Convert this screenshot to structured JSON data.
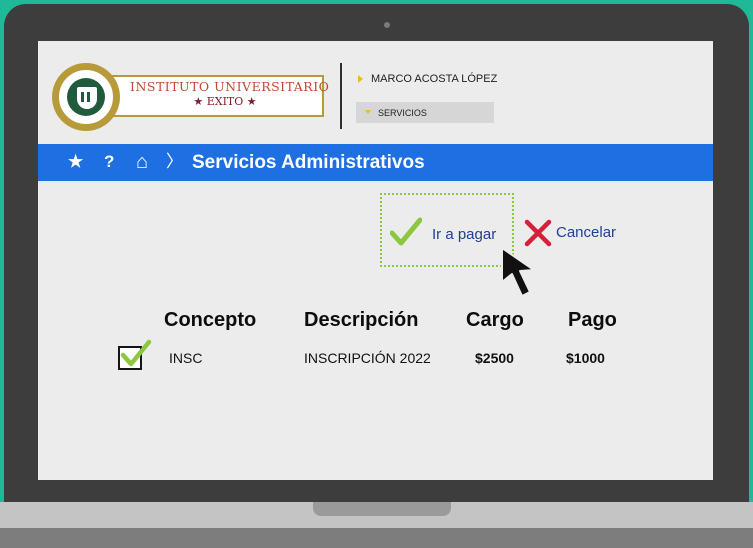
{
  "logo": {
    "name_line1": "INSTITUTO UNIVERSITARIO",
    "name_line2": "★ EXITO ★"
  },
  "user": {
    "name": "MARCO ACOSTA LÓPEZ"
  },
  "menu": {
    "services_label": "SERVICIOS"
  },
  "nav": {
    "icons": [
      "star-icon",
      "help-icon",
      "home-icon",
      "chevron-right-icon"
    ],
    "star_glyph": "★",
    "help_glyph": "?",
    "home_glyph": "⌂",
    "chevron_glyph": "〉",
    "title": "Servicios Administrativos"
  },
  "actions": {
    "pay_label": "Ir a pagar",
    "cancel_label": "Cancelar"
  },
  "table": {
    "headers": [
      "Concepto",
      "Descripción",
      "Cargo",
      "Pago"
    ],
    "rows": [
      {
        "selected": true,
        "concepto": "INSC",
        "descripcion": "INSCRIPCIÓN 2022",
        "cargo": "$2500",
        "pago": "$1000"
      }
    ]
  },
  "colors": {
    "background": "#1fb99a",
    "nav_bar": "#1e6fe1",
    "accent_yellow": "#f2b824",
    "check_green": "#8dc63f",
    "cancel_red": "#d71f3a",
    "link_blue": "#1f3f8f"
  }
}
